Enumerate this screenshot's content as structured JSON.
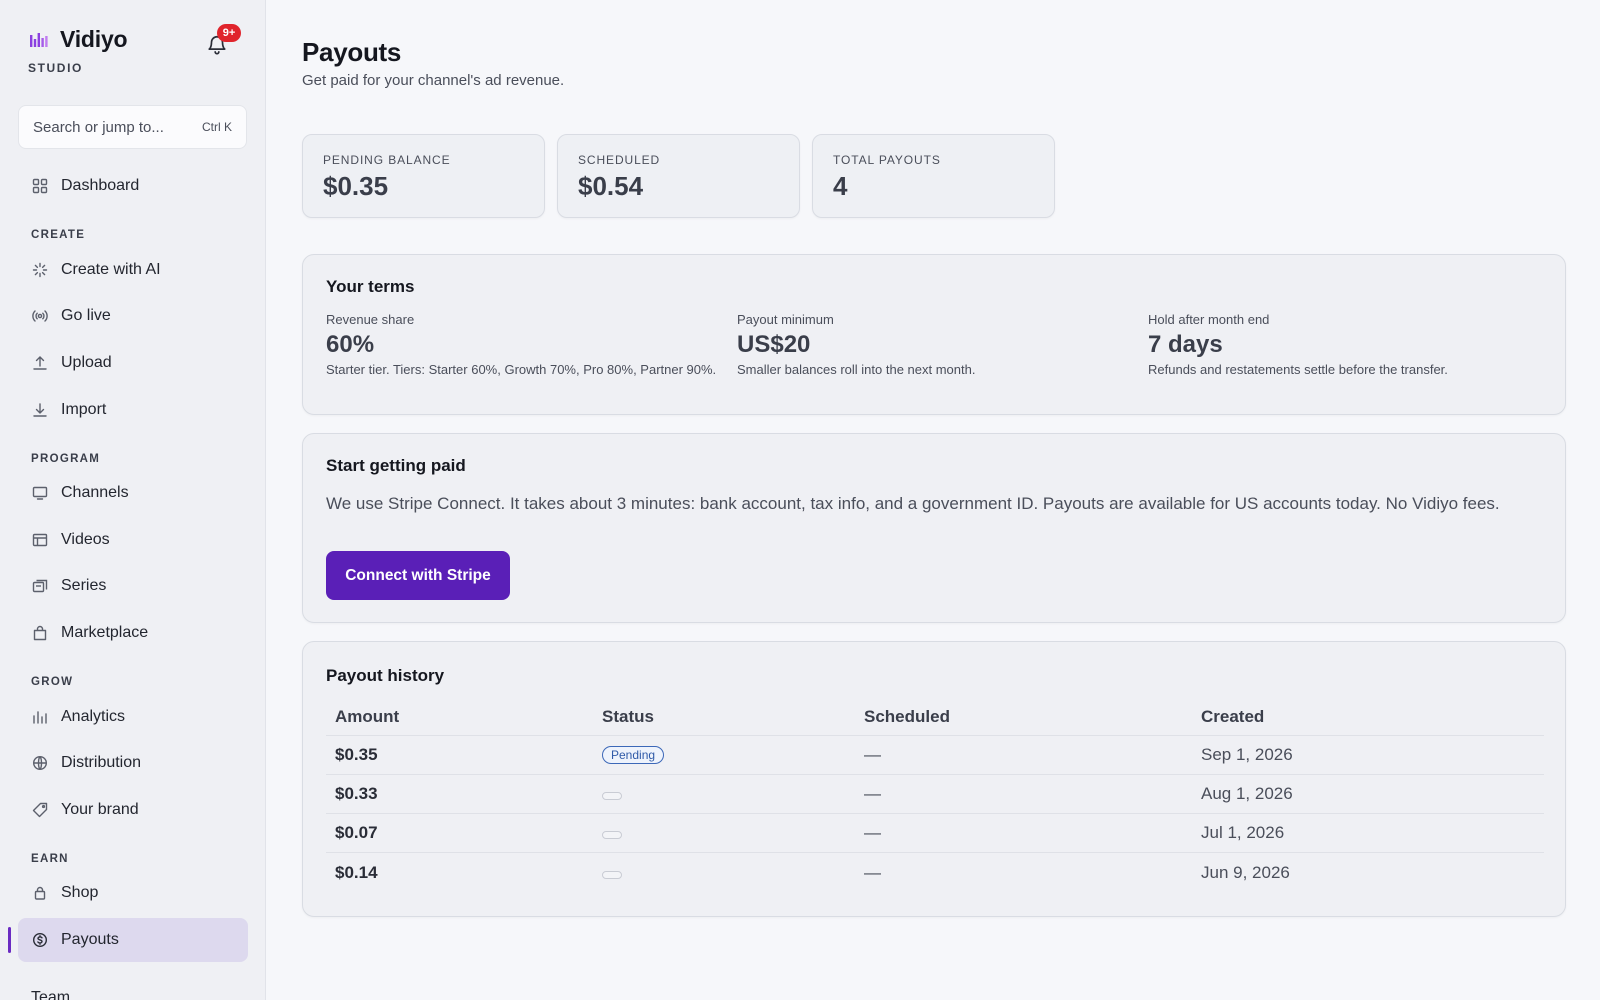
{
  "app": {
    "name": "Vidiyo",
    "subtitle": "STUDIO",
    "notification_badge": "9+"
  },
  "search": {
    "placeholder": "Search or jump to...",
    "shortcut": "Ctrl K"
  },
  "sidebar": {
    "dashboard": "Dashboard",
    "sections": {
      "create": "CREATE",
      "program": "PROGRAM",
      "grow": "GROW",
      "earn": "EARN"
    },
    "items": {
      "create_ai": "Create with AI",
      "go_live": "Go live",
      "upload": "Upload",
      "import": "Import",
      "channels": "Channels",
      "videos": "Videos",
      "series": "Series",
      "marketplace": "Marketplace",
      "analytics": "Analytics",
      "distribution": "Distribution",
      "your_brand": "Your brand",
      "shop": "Shop",
      "payouts": "Payouts",
      "team": "Team"
    },
    "active": "payouts"
  },
  "page": {
    "title": "Payouts",
    "subtitle": "Get paid for your channel's ad revenue."
  },
  "stats": [
    {
      "label": "PENDING BALANCE",
      "value": "$0.35"
    },
    {
      "label": "SCHEDULED",
      "value": "$0.54"
    },
    {
      "label": "TOTAL PAYOUTS",
      "value": "4"
    }
  ],
  "terms": {
    "title": "Your terms",
    "items": [
      {
        "label": "Revenue share",
        "value": "60%",
        "note": "Starter tier. Tiers: Starter 60%, Growth 70%, Pro 80%, Partner 90%."
      },
      {
        "label": "Payout minimum",
        "value": "US$20",
        "note": "Smaller balances roll into the next month."
      },
      {
        "label": "Hold after month end",
        "value": "7 days",
        "note": "Refunds and restatements settle before the transfer."
      }
    ]
  },
  "getting_paid": {
    "title": "Start getting paid",
    "text": "We use Stripe Connect. It takes about 3 minutes: bank account, tax info, and a government ID. Payouts are available for US accounts today. No Vidiyo fees.",
    "button": "Connect with Stripe"
  },
  "history": {
    "title": "Payout history",
    "columns": [
      "Amount",
      "Status",
      "Scheduled",
      "Created"
    ],
    "rows": [
      {
        "amount": "$0.35",
        "status": "Pending",
        "scheduled": "—",
        "created": "Sep 1, 2026"
      },
      {
        "amount": "$0.33",
        "status": "",
        "scheduled": "—",
        "created": "Aug 1, 2026"
      },
      {
        "amount": "$0.07",
        "status": "",
        "scheduled": "—",
        "created": "Jul 1, 2026"
      },
      {
        "amount": "$0.14",
        "status": "",
        "scheduled": "—",
        "created": "Jun 9, 2026"
      }
    ]
  },
  "colors": {
    "accent": "#5a1fb7",
    "active_nav_bg": "#ddd9ee",
    "badge": "#e0242c",
    "pending_pill": "#3c68b8"
  }
}
